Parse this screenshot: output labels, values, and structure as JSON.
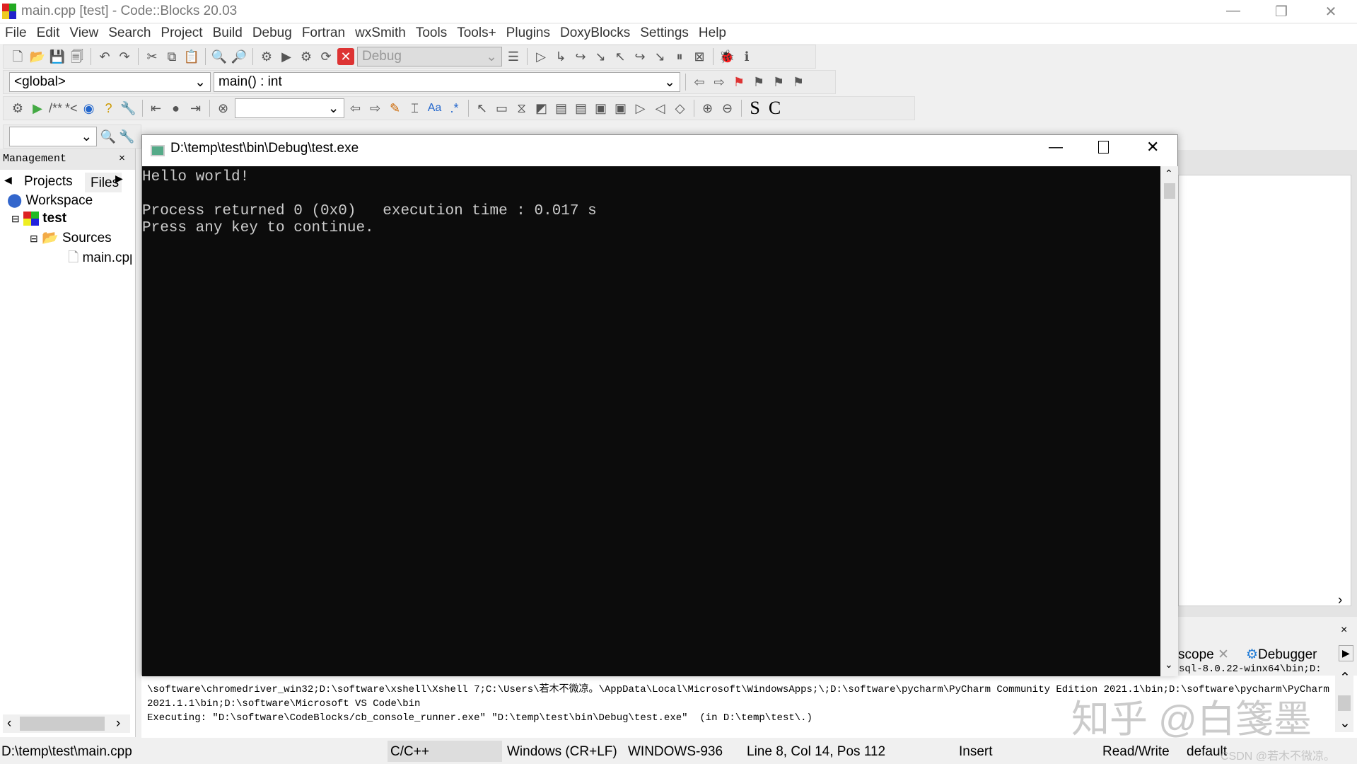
{
  "window": {
    "title": "main.cpp [test] - Code::Blocks 20.03"
  },
  "menu": [
    "File",
    "Edit",
    "View",
    "Search",
    "Project",
    "Build",
    "Debug",
    "Fortran",
    "wxSmith",
    "Tools",
    "Tools+",
    "Plugins",
    "DoxyBlocks",
    "Settings",
    "Help"
  ],
  "toolbar": {
    "build_target": "Debug",
    "scope": "<global>",
    "function": "main() : int",
    "comment_labels": [
      "/**",
      "*<"
    ],
    "letters": [
      "S",
      "C"
    ],
    "aa": "Aa",
    "regex": ".*"
  },
  "management": {
    "title": "Management",
    "tabs": [
      "Projects",
      "Files"
    ],
    "tree": {
      "workspace": "Workspace",
      "project": "test",
      "folder": "Sources",
      "file": "main.cpp"
    }
  },
  "console": {
    "title": "D:\\temp\\test\\bin\\Debug\\test.exe",
    "lines": [
      "Hello world!",
      "",
      "Process returned 0 (0x0)   execution time : 0.017 s",
      "Press any key to continue."
    ]
  },
  "logs": {
    "tabs": [
      "scope",
      "Debugger"
    ],
    "lines": [
      "sql-8.0.22-winx64\\bin;D:",
      "\\software\\chromedriver_win32;D:\\software\\xshell\\Xshell 7;C:\\Users\\若木不微凉。\\AppData\\Local\\Microsoft\\WindowsApps;\\;D:\\software\\pycharm\\PyCharm Community Edition 2021.1\\bin;D:\\software\\pycharm\\PyCharm",
      "2021.1.1\\bin;D:\\software\\Microsoft VS Code\\bin",
      "Executing: \"D:\\software\\CodeBlocks/cb_console_runner.exe\" \"D:\\temp\\test\\bin\\Debug\\test.exe\"  (in D:\\temp\\test\\.)"
    ]
  },
  "status": {
    "file": "D:\\temp\\test\\main.cpp",
    "lang": "C/C++",
    "eol": "Windows (CR+LF)",
    "encoding": "WINDOWS-936",
    "position": "Line 8, Col 14, Pos 112",
    "mode": "Insert",
    "access": "Read/Write",
    "profile": "default"
  },
  "watermarks": {
    "zhihu": "知乎 @白箋墨",
    "csdn": "CSDN @若木不微凉。"
  }
}
